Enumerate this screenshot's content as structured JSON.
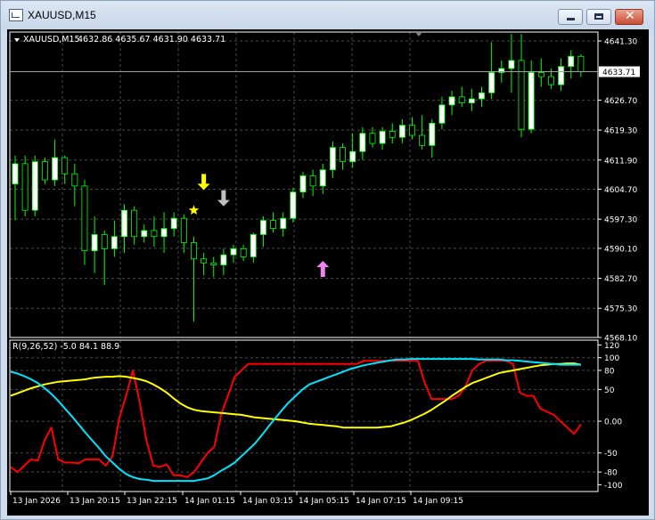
{
  "window": {
    "title": "XAUUSD,M15",
    "minimize_icon": "minimize-icon",
    "maximize_icon": "maximize-icon",
    "close_icon": "close-icon"
  },
  "colors": {
    "background": "#000000",
    "bull_candle": "#ffffff",
    "bear_candle": "#000000",
    "wick": "#00ff00",
    "grid": "#4a4a4a",
    "axis_text": "#ffffff",
    "bid_line": "#a0a0a0",
    "arrow_down_yellow": "#ffff00",
    "arrow_down_gray": "#c0c0c0",
    "arrow_up_violet": "#ee82ee",
    "star": "#ffff00",
    "red_line": "#ff0000",
    "yellow_line": "#ffff00",
    "cyan_line": "#00e5ff"
  },
  "chart_data": [
    {
      "type": "candlestick",
      "title": "XAUUSD,M15",
      "ohlc_header": "4632.86 4635.67 4631.90 4633.71",
      "menu_icon": "triangle-down-icon",
      "ylim": [
        4568.1,
        4643.5
      ],
      "y_ticks": [
        "4641.30",
        "4633.71",
        "4626.70",
        "4619.30",
        "4611.90",
        "4604.70",
        "4597.30",
        "4590.10",
        "4582.70",
        "4575.30",
        "4568.10"
      ],
      "current_price": "4633.71",
      "grid": true,
      "candles": [
        {
          "o": 4606.0,
          "h": 4613.0,
          "l": 4597.0,
          "c": 4611.0
        },
        {
          "o": 4611.0,
          "h": 4613.0,
          "l": 4598.0,
          "c": 4599.5
        },
        {
          "o": 4599.5,
          "h": 4613.0,
          "l": 4598.0,
          "c": 4611.5
        },
        {
          "o": 4611.5,
          "h": 4612.5,
          "l": 4606.0,
          "c": 4607.0
        },
        {
          "o": 4607.0,
          "h": 4617.0,
          "l": 4605.5,
          "c": 4612.5
        },
        {
          "o": 4612.5,
          "h": 4613.0,
          "l": 4606.0,
          "c": 4608.5
        },
        {
          "o": 4608.5,
          "h": 4611.0,
          "l": 4600.5,
          "c": 4605.5
        },
        {
          "o": 4605.5,
          "h": 4607.0,
          "l": 4586.0,
          "c": 4589.5
        },
        {
          "o": 4589.5,
          "h": 4598.0,
          "l": 4584.0,
          "c": 4593.5
        },
        {
          "o": 4593.5,
          "h": 4594.5,
          "l": 4581.0,
          "c": 4590.0
        },
        {
          "o": 4590.0,
          "h": 4597.0,
          "l": 4588.0,
          "c": 4593.0
        },
        {
          "o": 4593.0,
          "h": 4601.0,
          "l": 4589.0,
          "c": 4599.5
        },
        {
          "o": 4599.5,
          "h": 4600.5,
          "l": 4591.0,
          "c": 4593.0
        },
        {
          "o": 4593.0,
          "h": 4596.0,
          "l": 4591.5,
          "c": 4594.5
        },
        {
          "o": 4594.5,
          "h": 4598.0,
          "l": 4590.5,
          "c": 4593.0
        },
        {
          "o": 4593.0,
          "h": 4599.0,
          "l": 4589.0,
          "c": 4595.0
        },
        {
          "o": 4595.0,
          "h": 4599.0,
          "l": 4593.0,
          "c": 4597.5
        },
        {
          "o": 4597.5,
          "h": 4598.5,
          "l": 4589.0,
          "c": 4591.5
        },
        {
          "o": 4591.5,
          "h": 4593.0,
          "l": 4572.0,
          "c": 4587.5
        },
        {
          "o": 4587.5,
          "h": 4589.0,
          "l": 4583.5,
          "c": 4586.5
        },
        {
          "o": 4586.5,
          "h": 4588.0,
          "l": 4583.0,
          "c": 4586.0
        },
        {
          "o": 4586.0,
          "h": 4590.0,
          "l": 4583.5,
          "c": 4588.5
        },
        {
          "o": 4588.5,
          "h": 4591.0,
          "l": 4586.5,
          "c": 4590.0
        },
        {
          "o": 4590.0,
          "h": 4591.0,
          "l": 4587.0,
          "c": 4588.0
        },
        {
          "o": 4588.0,
          "h": 4594.0,
          "l": 4586.5,
          "c": 4593.5
        },
        {
          "o": 4593.5,
          "h": 4598.0,
          "l": 4590.5,
          "c": 4597.0
        },
        {
          "o": 4597.0,
          "h": 4599.0,
          "l": 4594.0,
          "c": 4595.0
        },
        {
          "o": 4595.0,
          "h": 4599.0,
          "l": 4593.0,
          "c": 4597.5
        },
        {
          "o": 4597.5,
          "h": 4605.0,
          "l": 4596.5,
          "c": 4604.0
        },
        {
          "o": 4604.0,
          "h": 4609.0,
          "l": 4602.5,
          "c": 4608.0
        },
        {
          "o": 4608.0,
          "h": 4609.5,
          "l": 4603.0,
          "c": 4605.5
        },
        {
          "o": 4605.5,
          "h": 4611.0,
          "l": 4603.5,
          "c": 4609.5
        },
        {
          "o": 4609.5,
          "h": 4616.5,
          "l": 4607.5,
          "c": 4615.0
        },
        {
          "o": 4615.0,
          "h": 4616.0,
          "l": 4609.5,
          "c": 4611.5
        },
        {
          "o": 4611.5,
          "h": 4618.5,
          "l": 4610.0,
          "c": 4614.0
        },
        {
          "o": 4614.0,
          "h": 4620.0,
          "l": 4612.0,
          "c": 4618.5
        },
        {
          "o": 4618.5,
          "h": 4620.0,
          "l": 4615.0,
          "c": 4616.0
        },
        {
          "o": 4616.0,
          "h": 4620.0,
          "l": 4614.5,
          "c": 4619.0
        },
        {
          "o": 4619.0,
          "h": 4621.0,
          "l": 4616.0,
          "c": 4617.5
        },
        {
          "o": 4617.5,
          "h": 4622.0,
          "l": 4616.0,
          "c": 4620.5
        },
        {
          "o": 4620.5,
          "h": 4622.5,
          "l": 4617.0,
          "c": 4618.0
        },
        {
          "o": 4618.0,
          "h": 4623.0,
          "l": 4614.5,
          "c": 4615.5
        },
        {
          "o": 4615.5,
          "h": 4622.0,
          "l": 4612.5,
          "c": 4621.0
        },
        {
          "o": 4621.0,
          "h": 4627.5,
          "l": 4619.5,
          "c": 4625.5
        },
        {
          "o": 4625.5,
          "h": 4629.0,
          "l": 4623.0,
          "c": 4627.5
        },
        {
          "o": 4627.5,
          "h": 4630.0,
          "l": 4625.0,
          "c": 4626.0
        },
        {
          "o": 4626.0,
          "h": 4629.5,
          "l": 4624.0,
          "c": 4627.0
        },
        {
          "o": 4627.0,
          "h": 4630.0,
          "l": 4625.0,
          "c": 4628.5
        },
        {
          "o": 4628.5,
          "h": 4641.0,
          "l": 4627.0,
          "c": 4633.5
        },
        {
          "o": 4633.5,
          "h": 4636.5,
          "l": 4631.0,
          "c": 4634.5
        },
        {
          "o": 4634.5,
          "h": 4643.0,
          "l": 4628.5,
          "c": 4636.5
        },
        {
          "o": 4636.5,
          "h": 4643.0,
          "l": 4617.5,
          "c": 4619.5
        },
        {
          "o": 4619.5,
          "h": 4636.5,
          "l": 4618.5,
          "c": 4633.5
        },
        {
          "o": 4633.5,
          "h": 4637.0,
          "l": 4630.0,
          "c": 4632.5
        },
        {
          "o": 4632.5,
          "h": 4634.5,
          "l": 4629.5,
          "c": 4630.5
        },
        {
          "o": 4630.5,
          "h": 4637.0,
          "l": 4629.0,
          "c": 4635.0
        },
        {
          "o": 4635.0,
          "h": 4639.0,
          "l": 4632.0,
          "c": 4637.5
        },
        {
          "o": 4637.5,
          "h": 4638.0,
          "l": 4632.5,
          "c": 4633.7
        }
      ],
      "signals": [
        {
          "type": "arrow-down",
          "color": "#ffff00",
          "candle": 19,
          "price": 4604.5
        },
        {
          "type": "arrow-down",
          "color": "#c0c0c0",
          "candle": 21,
          "price": 4600.5
        },
        {
          "type": "star",
          "color": "#ffff00",
          "candle": 18,
          "price": 4599.5
        },
        {
          "type": "arrow-up",
          "color": "#ee82ee",
          "candle": 31,
          "price": 4587.0
        }
      ]
    },
    {
      "type": "line",
      "title": "R(9,26,52) -5.0 84.1 88.9",
      "ylim": [
        -105,
        122
      ],
      "y_ticks": [
        "120",
        "100",
        "80",
        "50",
        "0.00",
        "-50",
        "-80",
        "-100"
      ],
      "x_tick_labels": [
        "13 Jan 2026",
        "13 Jan 20:15",
        "13 Jan 22:15",
        "14 Jan 01:15",
        "14 Jan 03:15",
        "14 Jan 05:15",
        "14 Jan 07:15",
        "14 Jan 09:15"
      ],
      "series": [
        {
          "color": "#ff0000",
          "values": [
            -72,
            -80,
            -70,
            -60,
            -62,
            -30,
            -10,
            -60,
            -65,
            -65,
            -66,
            -60,
            -60,
            -60,
            -70,
            -55,
            5,
            40,
            80,
            30,
            -30,
            -70,
            -72,
            -68,
            -85,
            -85,
            -88,
            -80,
            -65,
            -50,
            -40,
            10,
            40,
            70,
            80,
            90,
            90,
            90,
            90,
            90,
            90,
            90,
            90,
            90,
            90,
            90,
            90,
            90,
            90,
            90,
            90,
            90,
            95,
            95,
            95,
            95,
            95,
            95,
            95,
            95,
            95,
            60,
            35,
            35,
            35,
            35,
            40,
            55,
            80,
            90,
            95,
            95,
            95,
            95,
            90,
            45,
            40,
            40,
            20,
            15,
            10,
            0,
            -10,
            -20,
            -5
          ]
        },
        {
          "color": "#ffff00",
          "values": [
            40,
            44,
            48,
            52,
            55,
            58,
            60,
            62,
            63,
            64,
            65,
            66,
            68,
            69,
            70,
            70,
            71,
            70,
            68,
            66,
            63,
            58,
            52,
            45,
            36,
            28,
            22,
            18,
            16,
            15,
            14,
            13,
            12,
            11,
            10,
            8,
            6,
            5,
            4,
            3,
            2,
            1,
            0,
            -2,
            -4,
            -5,
            -6,
            -7,
            -8,
            -10,
            -10,
            -10,
            -10,
            -10,
            -10,
            -9,
            -8,
            -5,
            -2,
            2,
            7,
            12,
            18,
            25,
            32,
            40,
            47,
            54,
            60,
            64,
            68,
            72,
            76,
            78,
            80,
            82,
            84,
            86,
            88,
            89,
            90,
            90,
            91,
            91,
            89
          ]
        },
        {
          "color": "#00e5ff",
          "values": [
            78,
            75,
            71,
            66,
            60,
            52,
            43,
            32,
            20,
            8,
            -5,
            -18,
            -30,
            -42,
            -55,
            -65,
            -75,
            -83,
            -88,
            -91,
            -92,
            -94,
            -94,
            -94,
            -94,
            -94,
            -94,
            -94,
            -92,
            -90,
            -85,
            -78,
            -72,
            -65,
            -55,
            -45,
            -35,
            -22,
            -8,
            5,
            18,
            30,
            40,
            50,
            58,
            62,
            66,
            70,
            74,
            78,
            82,
            85,
            88,
            90,
            92,
            94,
            96,
            97,
            97,
            98,
            98,
            98,
            98,
            98,
            98,
            98,
            98,
            98,
            98,
            97,
            97,
            97,
            97,
            96,
            96,
            95,
            94,
            93,
            92,
            91,
            90,
            89,
            89,
            89,
            89
          ]
        }
      ]
    }
  ]
}
